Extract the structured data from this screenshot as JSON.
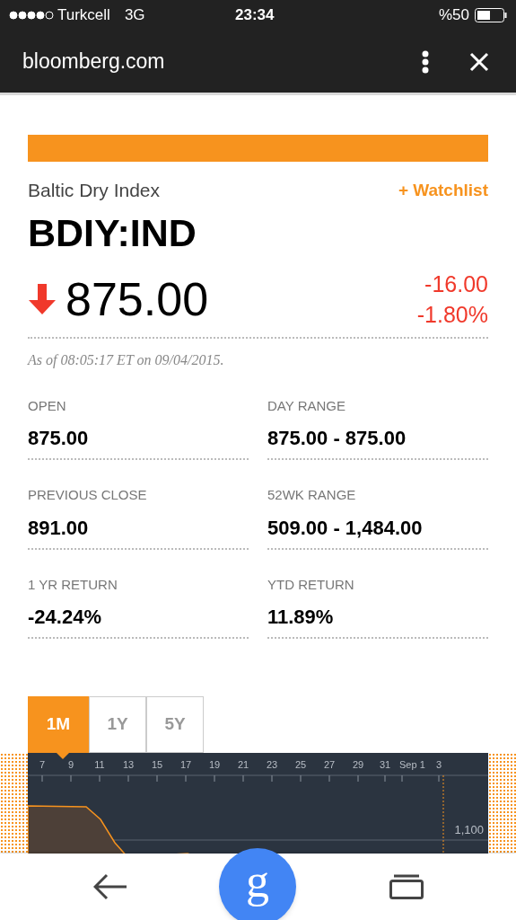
{
  "status_bar": {
    "carrier": "Turkcell",
    "network": "3G",
    "time": "23:34",
    "battery": "%50"
  },
  "browser": {
    "url": "bloomberg.com"
  },
  "quote": {
    "name": "Baltic Dry Index",
    "watchlist": "+ Watchlist",
    "ticker": "BDIY:IND",
    "down": true,
    "price": "875.00",
    "change": "-16.00",
    "change_percent": "-1.80%",
    "as_of": "As of 08:05:17 ET on 09/04/2015."
  },
  "stats": [
    {
      "label": "OPEN",
      "value": "875.00"
    },
    {
      "label": "DAY RANGE",
      "value": "875.00 - 875.00"
    },
    {
      "label": "PREVIOUS CLOSE",
      "value": "891.00"
    },
    {
      "label": "52WK RANGE",
      "value": "509.00 - 1,484.00"
    },
    {
      "label": "1 YR RETURN",
      "value": "-24.24%"
    },
    {
      "label": "YTD RETURN",
      "value": "11.89%"
    }
  ],
  "chart": {
    "tabs": [
      {
        "label": "1M",
        "selected": true
      },
      {
        "label": "1Y",
        "selected": false
      },
      {
        "label": "5Y",
        "selected": false
      }
    ],
    "x_labels": [
      "7",
      "9",
      "11",
      "13",
      "15",
      "17",
      "19",
      "21",
      "23",
      "25",
      "27",
      "29",
      "31",
      "Sep 1",
      "3"
    ],
    "y_labels": [
      "1,100"
    ]
  },
  "bottom_bar": {
    "home_button": "g"
  }
}
